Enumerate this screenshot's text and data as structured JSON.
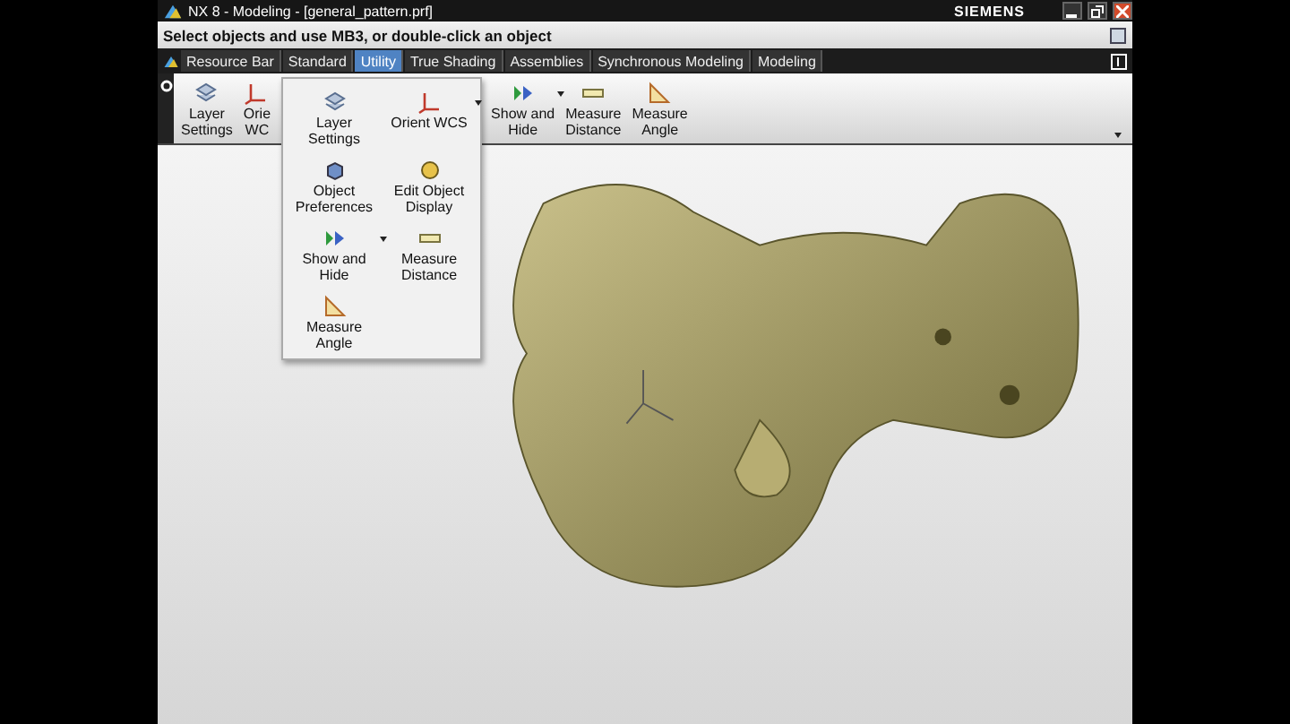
{
  "window": {
    "title": "NX 8 - Modeling - [general_pattern.prf]",
    "brand": "SIEMENS"
  },
  "prompt": "Select objects and use MB3, or double-click an object",
  "tabs": [
    {
      "label": "Resource Bar",
      "selected": false
    },
    {
      "label": "Standard",
      "selected": false
    },
    {
      "label": "Utility",
      "selected": true
    },
    {
      "label": "True Shading",
      "selected": false
    },
    {
      "label": "Assemblies",
      "selected": false
    },
    {
      "label": "Synchronous Modeling",
      "selected": false
    },
    {
      "label": "Modeling",
      "selected": false
    }
  ],
  "ribbon_left": [
    {
      "lines": [
        "Layer",
        "Settings"
      ],
      "has_menu": false
    },
    {
      "lines": [
        "Orie",
        "WC"
      ],
      "has_menu": false
    }
  ],
  "ribbon_right": [
    {
      "lines": [
        "Show and",
        "Hide"
      ],
      "has_menu": true
    },
    {
      "lines": [
        "Measure",
        "Distance"
      ],
      "has_menu": false
    },
    {
      "lines": [
        "Measure",
        "Angle"
      ],
      "has_menu": false
    }
  ],
  "menu": [
    {
      "lines": [
        "Layer",
        "Settings"
      ],
      "has_menu": false
    },
    {
      "lines": [
        "Orient WCS"
      ],
      "has_menu": true
    },
    {
      "lines": [
        "Object",
        "Preferences"
      ],
      "has_menu": false
    },
    {
      "lines": [
        "Edit Object",
        "Display"
      ],
      "has_menu": false
    },
    {
      "lines": [
        "Show and",
        "Hide"
      ],
      "has_menu": true
    },
    {
      "lines": [
        "Measure",
        "Distance"
      ],
      "has_menu": false
    },
    {
      "lines": [
        "Measure",
        "Angle"
      ],
      "has_menu": false
    }
  ]
}
